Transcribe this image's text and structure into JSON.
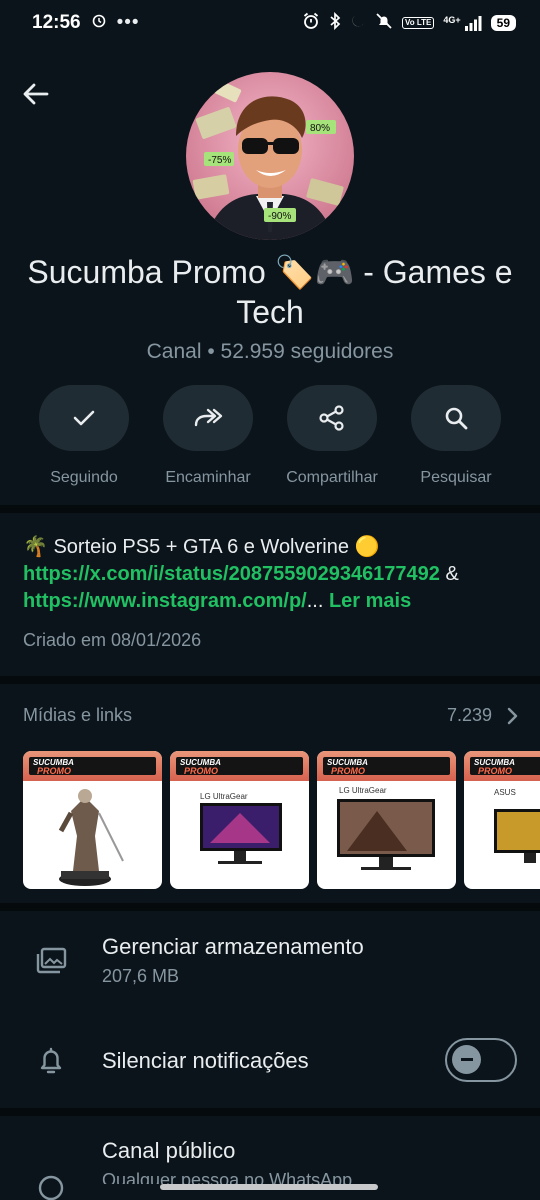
{
  "status": {
    "time": "12:56",
    "network": "4G+",
    "volte": "Vo LTE",
    "battery": "59"
  },
  "channel": {
    "name": "Sucumba Promo 🏷️🎮  - Games e Tech",
    "subtitle": "Canal • 52.959 seguidores",
    "avatar_tags": [
      "80%",
      "-75%",
      "-90%"
    ]
  },
  "actions": [
    {
      "label": "Seguindo",
      "icon": "check-icon"
    },
    {
      "label": "Encaminhar",
      "icon": "forward-icon"
    },
    {
      "label": "Compartilhar",
      "icon": "share-icon"
    },
    {
      "label": "Pesquisar",
      "icon": "search-icon"
    }
  ],
  "description": {
    "text": "🌴 Sorteio PS5 + GTA 6 e Wolverine 🟡",
    "link1": "https://x.com/i/status/2087559029346177492",
    "amp": " &",
    "link2": "https://www.instagram.com/p/",
    "ellipsis": "...",
    "read_more": "Ler mais",
    "created": "Criado em 08/01/2026"
  },
  "media": {
    "title": "Mídias e links",
    "count": "7.239",
    "thumbs": [
      {
        "brand": "SUCUMBA",
        "promo": "PROMO",
        "product_label": ""
      },
      {
        "brand": "SUCUMBA",
        "promo": "PROMO",
        "product_label": "LG UltraGear"
      },
      {
        "brand": "SUCUMBA",
        "promo": "PROMO",
        "product_label": "LG UltraGear"
      },
      {
        "brand": "SUCUMBA",
        "promo": "PROMO",
        "product_label": "ASUS"
      }
    ]
  },
  "storage": {
    "title": "Gerenciar armazenamento",
    "size": "207,6 MB"
  },
  "mute": {
    "title": "Silenciar notificações",
    "enabled": false
  },
  "public": {
    "title": "Canal público",
    "subtitle": "Qualquer pessoa no WhatsApp"
  },
  "colors": {
    "background": "#0b141a",
    "accent_green": "#21c063",
    "muted_text": "#8696a0"
  }
}
